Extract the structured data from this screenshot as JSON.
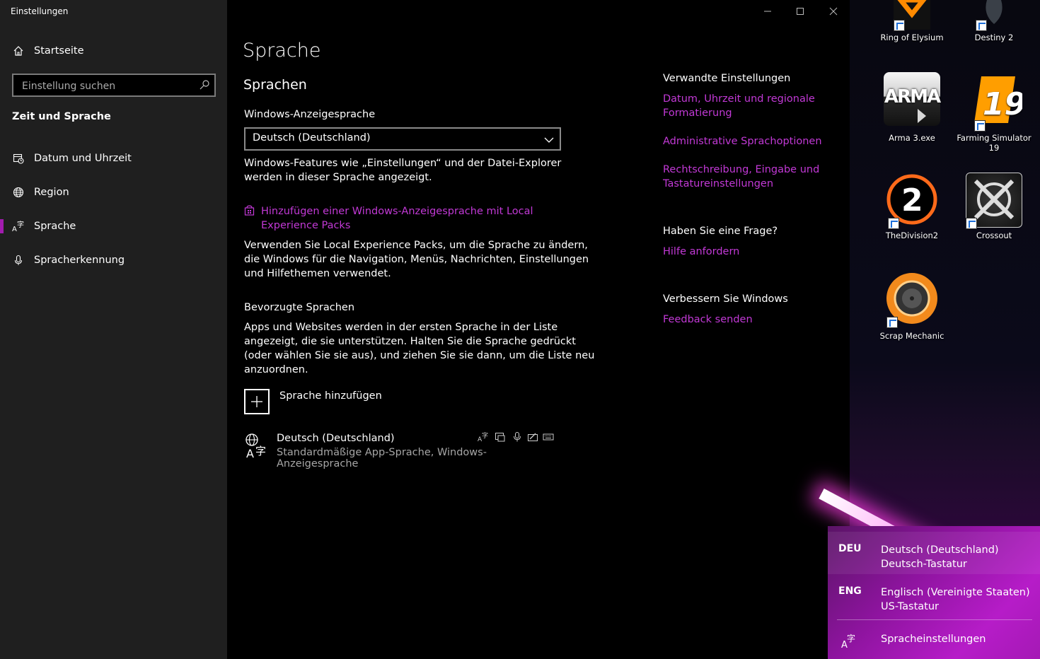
{
  "window": {
    "app_title": "Einstellungen"
  },
  "sidebar": {
    "home_label": "Startseite",
    "search_placeholder": "Einstellung suchen",
    "section_header": "Zeit und Sprache",
    "items": [
      {
        "label": "Datum und Uhrzeit",
        "icon": "calendar-clock-icon"
      },
      {
        "label": "Region",
        "icon": "globe-icon"
      },
      {
        "label": "Sprache",
        "icon": "language-icon",
        "active": true
      },
      {
        "label": "Spracherkennung",
        "icon": "microphone-icon"
      }
    ]
  },
  "main": {
    "page_title": "Sprache",
    "section_title": "Sprachen",
    "display_language_label": "Windows-Anzeigesprache",
    "display_language_value": "Deutsch (Deutschland)",
    "display_language_desc_1": "Windows-Features wie „Einstellungen“ und der Datei-Explorer",
    "display_language_desc_2": "werden in dieser Sprache angezeigt.",
    "lep_link_1": "Hinzufügen einer Windows-Anzeigesprache mit Local",
    "lep_link_2": "Experience Packs",
    "lep_desc_1": "Verwenden Sie Local Experience Packs, um die Sprache zu ändern,",
    "lep_desc_2": "die Windows für die Navigation, Menüs, Nachrichten, Einstellungen",
    "lep_desc_3": "und Hilfethemen verwendet.",
    "preferred_title": "Bevorzugte Sprachen",
    "preferred_desc_1": "Apps und Websites werden in der ersten Sprache in der Liste",
    "preferred_desc_2": "angezeigt, die sie unterstützen. Halten Sie die Sprache gedrückt",
    "preferred_desc_3": "(oder wählen Sie sie aus), und ziehen Sie sie dann, um die Liste neu",
    "preferred_desc_4": "anzuordnen.",
    "add_language_label": "Sprache hinzufügen",
    "language_entry": {
      "name": "Deutsch (Deutschland)",
      "subtitle": "Standardmäßige App-Sprache, Windows-Anzeigesprache"
    }
  },
  "related": {
    "heading": "Verwandte Einstellungen",
    "link1_a": "Datum, Uhrzeit und regionale",
    "link1_b": "Formatierung",
    "link2": "Administrative Sprachoptionen",
    "link3_a": "Rechtschreibung, Eingabe und",
    "link3_b": "Tastatureinstellungen",
    "question_heading": "Haben Sie eine Frage?",
    "help_link": "Hilfe anfordern",
    "improve_heading": "Verbessern Sie Windows",
    "feedback_link": "Feedback senden"
  },
  "desktop": {
    "icons": [
      {
        "label": "Ring of Elysium"
      },
      {
        "label": "Destiny 2"
      },
      {
        "label": "Arma 3.exe"
      },
      {
        "label_1": "Farming Simulator",
        "label_2": "19"
      },
      {
        "label": "TheDivision2"
      },
      {
        "label": "Crossout"
      },
      {
        "label": "Scrap Mechanic"
      }
    ]
  },
  "flyout": {
    "items": [
      {
        "code": "DEU",
        "line1": "Deutsch (Deutschland)",
        "line2": "Deutsch-Tastatur"
      },
      {
        "code": "ENG",
        "line1": "Englisch (Vereinigte Staaten)",
        "line2": "US-Tastatur"
      }
    ],
    "settings_label": "Spracheinstellungen"
  },
  "colors": {
    "accent": "#c239d6",
    "sidebar_bg": "#1f1f1f",
    "main_bg": "#000000"
  }
}
